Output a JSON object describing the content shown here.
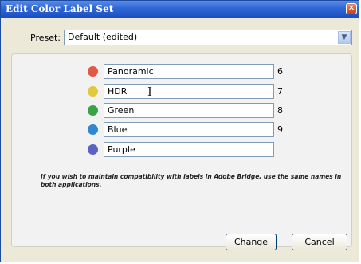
{
  "window": {
    "title": "Edit Color Label Set"
  },
  "preset": {
    "label": "Preset:",
    "value": "Default (edited)"
  },
  "labels": [
    {
      "name": "Panoramic",
      "number": "6",
      "color": "#e05a47"
    },
    {
      "name": "HDR",
      "number": "7",
      "color": "#e2c93a"
    },
    {
      "name": "Green",
      "number": "8",
      "color": "#3aa345"
    },
    {
      "name": "Blue",
      "number": "9",
      "color": "#2f86d1"
    },
    {
      "name": "Purple",
      "number": "",
      "color": "#5a62c4"
    }
  ],
  "note": "If you wish to maintain compatibility with labels in Adobe Bridge, use the same names in both applications.",
  "buttons": {
    "change": "Change",
    "cancel": "Cancel"
  },
  "icons": {
    "close": "close-icon",
    "dropdown": "chevron-down-icon",
    "cursor": "text-cursor-icon"
  }
}
